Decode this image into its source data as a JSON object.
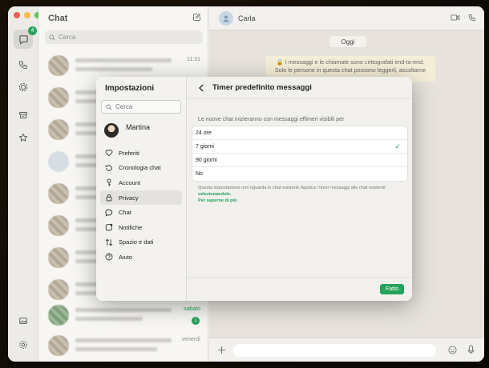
{
  "chat_list": {
    "title": "Chat",
    "search_placeholder": "Cerca",
    "rows": [
      {
        "time": "11:31",
        "unread": ""
      },
      {
        "time": "",
        "unread": ""
      },
      {
        "time": "",
        "unread": ""
      },
      {
        "time": "",
        "unread": ""
      },
      {
        "time": "",
        "unread": ""
      },
      {
        "time": "",
        "unread": ""
      },
      {
        "time": "",
        "unread": ""
      },
      {
        "time": "",
        "unread": ""
      },
      {
        "time": "",
        "unread": ""
      },
      {
        "time": "sabato",
        "unread": "1"
      },
      {
        "time": "venerdì",
        "unread": ""
      }
    ]
  },
  "rail": {
    "chats_badge": "4"
  },
  "conversation": {
    "contact_name": "Carla",
    "date_pill": "Oggi",
    "encryption_notice": "🔒 I messaggi e le chiamate sono crittografati end-to-end. Solo le persone in questa chat possono leggerli, ascoltarne"
  },
  "settings": {
    "title": "Impostazioni",
    "search_placeholder": "Cerca",
    "profile_name": "Martina",
    "menu": [
      {
        "label": "Preferiti",
        "icon": "heart-icon"
      },
      {
        "label": "Cronologia chat",
        "icon": "history-icon"
      },
      {
        "label": "Account",
        "icon": "key-icon"
      },
      {
        "label": "Privacy",
        "icon": "lock-icon"
      },
      {
        "label": "Chat",
        "icon": "chat-bubble-icon"
      },
      {
        "label": "Notifiche",
        "icon": "bell-icon"
      },
      {
        "label": "Spazio e dati",
        "icon": "arrows-icon"
      },
      {
        "label": "Aiuto",
        "icon": "help-icon"
      }
    ],
    "active_menu": "Privacy",
    "panel": {
      "title": "Timer predefinito messaggi",
      "subtitle": "Le nuove chat inizieranno con messaggi effimeri visibili per",
      "options": [
        "24 ore",
        "7 giorni",
        "90 giorni",
        "No"
      ],
      "selected": "7 giorni",
      "note_text": "Questa impostazione non riguarda le chat esistenti. Applica i timer messaggi alle chat esistenti",
      "note_link_inline": "selezionandole.",
      "note_link": "Per saperne di più",
      "done_label": "Fatto"
    }
  },
  "colors": {
    "accent": "#25a35a"
  }
}
